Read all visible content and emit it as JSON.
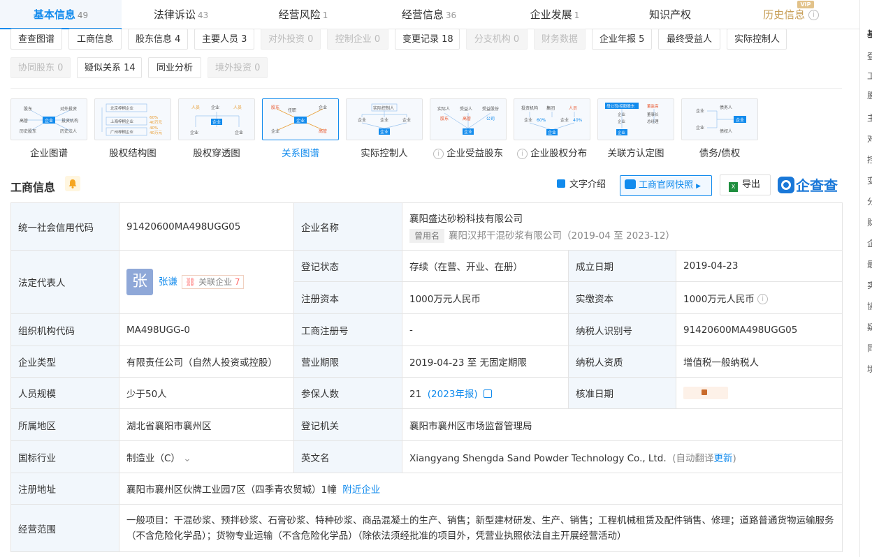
{
  "tabs": [
    {
      "label": "基本信息",
      "count": "49"
    },
    {
      "label": "法律诉讼",
      "count": "43"
    },
    {
      "label": "经营风险",
      "count": "1"
    },
    {
      "label": "经营信息",
      "count": "36"
    },
    {
      "label": "企业发展",
      "count": "1"
    },
    {
      "label": "知识产权",
      "count": ""
    },
    {
      "label": "历史信息",
      "count": "",
      "badge": "VIP"
    }
  ],
  "chips": [
    {
      "label": "查查图谱",
      "disabled": false
    },
    {
      "label": "工商信息",
      "disabled": false
    },
    {
      "label": "股东信息 4",
      "disabled": false
    },
    {
      "label": "主要人员 3",
      "disabled": false
    },
    {
      "label": "对外投资 0",
      "disabled": true
    },
    {
      "label": "控制企业 0",
      "disabled": true
    },
    {
      "label": "变更记录 18",
      "disabled": false
    },
    {
      "label": "分支机构 0",
      "disabled": true
    },
    {
      "label": "财务数据",
      "disabled": true
    },
    {
      "label": "企业年报 5",
      "disabled": false
    },
    {
      "label": "最终受益人",
      "disabled": false
    },
    {
      "label": "实际控制人",
      "disabled": false
    },
    {
      "label": "协同股东 0",
      "disabled": true
    },
    {
      "label": "疑似关系 14",
      "disabled": false
    },
    {
      "label": "同业分析",
      "disabled": false
    },
    {
      "label": "境外投资 0",
      "disabled": true
    }
  ],
  "graphs": [
    {
      "label": "企业图谱",
      "info": false,
      "selected": false
    },
    {
      "label": "股权结构图",
      "info": false,
      "selected": false
    },
    {
      "label": "股权穿透图",
      "info": false,
      "selected": false
    },
    {
      "label": "关系图谱",
      "info": false,
      "selected": true
    },
    {
      "label": "实际控制人",
      "info": false,
      "selected": false
    },
    {
      "label": "企业受益股东",
      "info": true,
      "selected": false
    },
    {
      "label": "企业股权分布",
      "info": true,
      "selected": false
    },
    {
      "label": "关联方认定图",
      "info": false,
      "selected": false
    },
    {
      "label": "债务/债权",
      "info": false,
      "selected": false
    }
  ],
  "thumb_text": {
    "g1": [
      "股东",
      "对外投资",
      "高管",
      "企业",
      "投资机构",
      "历史股东",
      "历史法人"
    ],
    "g2": [
      "北京梓桐企业",
      "上海梓桐企业",
      "广州梓桐企业",
      "60%",
      "40万元",
      "40%",
      "40万元"
    ],
    "g3": [
      "人员",
      "企业",
      "人员",
      "企业",
      "企业",
      "企业"
    ],
    "g4": [
      "股东",
      "任职",
      "企业",
      "企业",
      "企业",
      "高管"
    ],
    "g5": [
      "实际控制人",
      "企业",
      "企业",
      "企业",
      "企业"
    ],
    "g6": [
      "实际人",
      "受益人",
      "受益股份",
      "股东",
      "高管",
      "公司",
      "企业"
    ],
    "g7": [
      "投资机构",
      "集团",
      "人员",
      "企业",
      "60%",
      "企业",
      "40%",
      "企业"
    ],
    "g8": [
      "母公司/控股股东",
      "董监高",
      "企业",
      "董事长",
      "企业",
      "总经理",
      "企业"
    ],
    "g9": [
      "企业",
      "债务人",
      "企业",
      "企业",
      "债权人"
    ]
  },
  "section": {
    "title": "工商信息",
    "intro_label": "文字介绍",
    "snapshot_label": "工商官网快照",
    "export_label": "导出",
    "brand": "企查查"
  },
  "info": {
    "credit_code_label": "统一社会信用代码",
    "credit_code": "91420600MA498UGG05",
    "name_label": "企业名称",
    "name": "襄阳盛达砂粉科技有限公司",
    "former_tag": "曾用名",
    "former_name": "襄阳汉邦干混砂浆有限公司（2019-04 至 2023-12）",
    "legal_label": "法定代表人",
    "legal_avatar": "张",
    "legal_name": "张谦",
    "legal_related": "关联企业",
    "legal_related_count": "7",
    "status_label": "登记状态",
    "status": "存续（在营、开业、在册）",
    "founded_label": "成立日期",
    "founded": "2019-04-23",
    "reg_capital_label": "注册资本",
    "reg_capital": "1000万元人民币",
    "paid_capital_label": "实缴资本",
    "paid_capital": "1000万元人民币",
    "org_code_label": "组织机构代码",
    "org_code": "MA498UGG-0",
    "reg_no_label": "工商注册号",
    "reg_no": "-",
    "taxpayer_id_label": "纳税人识别号",
    "taxpayer_id": "91420600MA498UGG05",
    "type_label": "企业类型",
    "type": "有限责任公司（自然人投资或控股）",
    "term_label": "营业期限",
    "term": "2019-04-23 至 无固定期限",
    "tax_qual_label": "纳税人资质",
    "tax_qual": "增值税一般纳税人",
    "staff_label": "人员规模",
    "staff": "少于50人",
    "insured_label": "参保人数",
    "insured": "21",
    "insured_year": "(2023年报)",
    "approve_label": "核准日期",
    "region_label": "所属地区",
    "region": "湖北省襄阳市襄州区",
    "authority_label": "登记机关",
    "authority": "襄阳市襄州区市场监督管理局",
    "industry_label": "国标行业",
    "industry": "制造业（C）",
    "en_label": "英文名",
    "en_name": "Xiangyang Shengda Sand Powder Technology Co., Ltd.",
    "en_note_a": "(自动翻译",
    "en_note_b": "更新",
    "en_note_c": ")",
    "address_label": "注册地址",
    "address": "襄阳市襄州区伙牌工业园7区（四季青农贸城）1幢",
    "nearby": "附近企业",
    "scope_label": "经营范围",
    "scope": "一般项目：干混砂浆、预拌砂浆、石膏砂浆、特种砂浆、商品混凝土的生产、销售；新型建材研发、生产、销售；工程机械租赁及配件销售、修理；道路普通货物运输服务（不含危险化学品）；货物专业运输（不含危险化学品）（除依法须经批准的项目外，凭营业执照依法自主开展经营活动）"
  },
  "sidebar_chars": [
    "基",
    "登",
    "工",
    "股",
    "主",
    "对",
    "控",
    "变",
    "分",
    "财",
    "企",
    "最",
    "实",
    "协",
    "疑",
    "同",
    "境"
  ],
  "colors": {
    "accent": "#128bed",
    "key_bg": "#f2f7fc",
    "history": "#c8a05a"
  }
}
